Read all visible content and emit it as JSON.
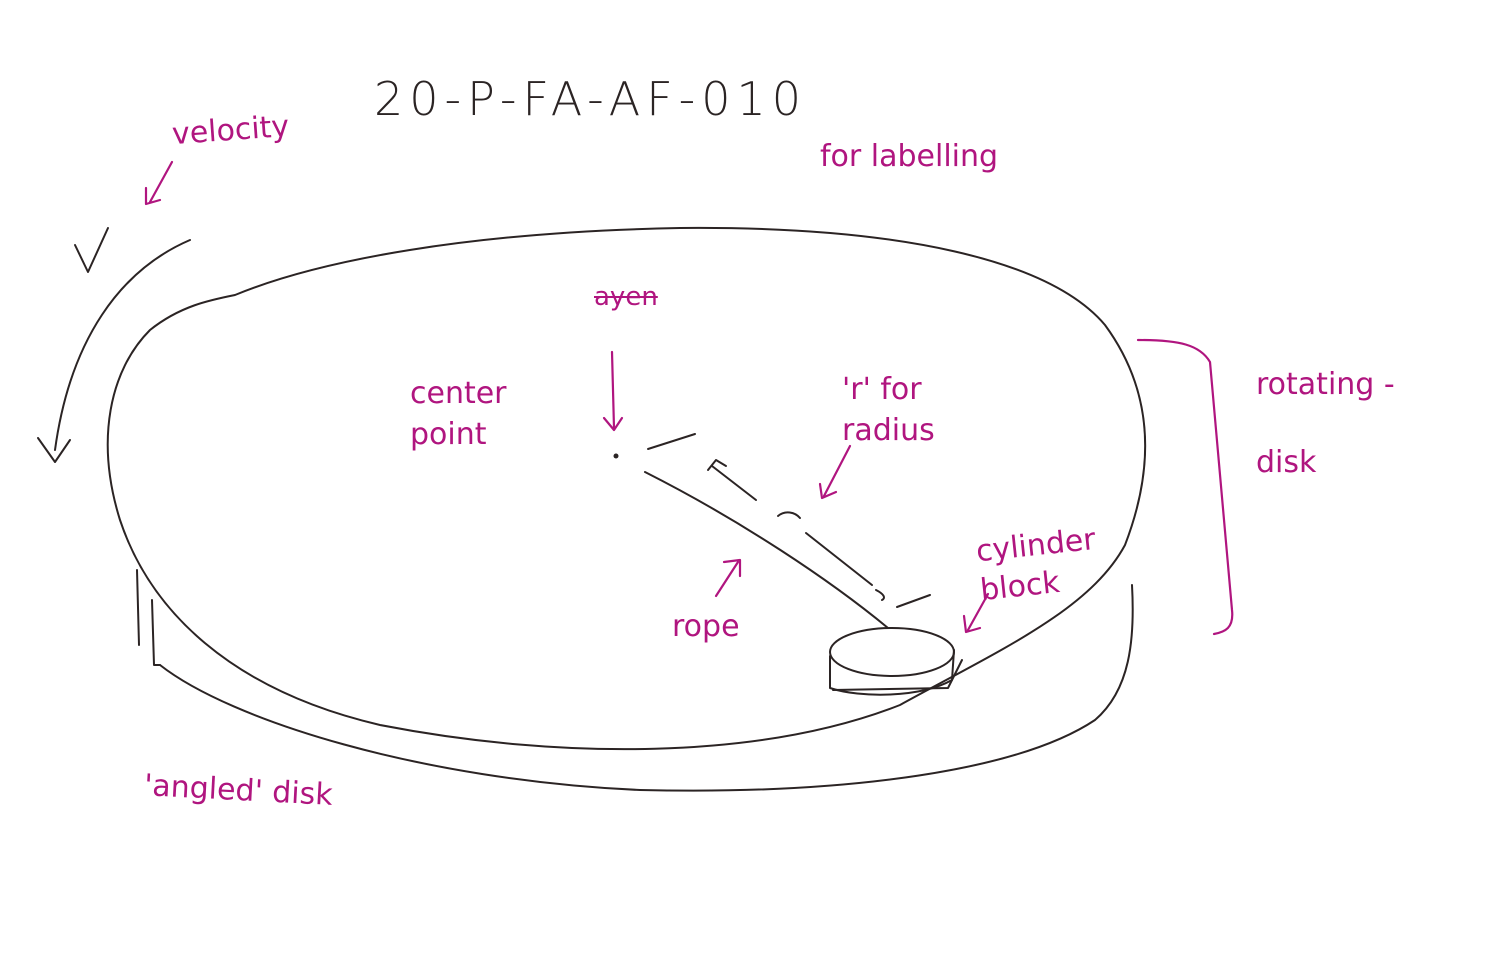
{
  "title_code": "20-P-FA-AF-010",
  "labels": {
    "velocity": "velocity",
    "for_labelling": "for labelling",
    "struck_word": "ayen",
    "center_point": "center point",
    "r_for_radius": "'r' for radius",
    "rotating_disk": "rotating - disk",
    "cylinder_block": "cylinder block",
    "rope": "rope",
    "angled_disk": "'angled' disk"
  },
  "colors": {
    "pencil": "#2b2424",
    "annotation": "#b0157f",
    "paper": "#ffffff"
  }
}
